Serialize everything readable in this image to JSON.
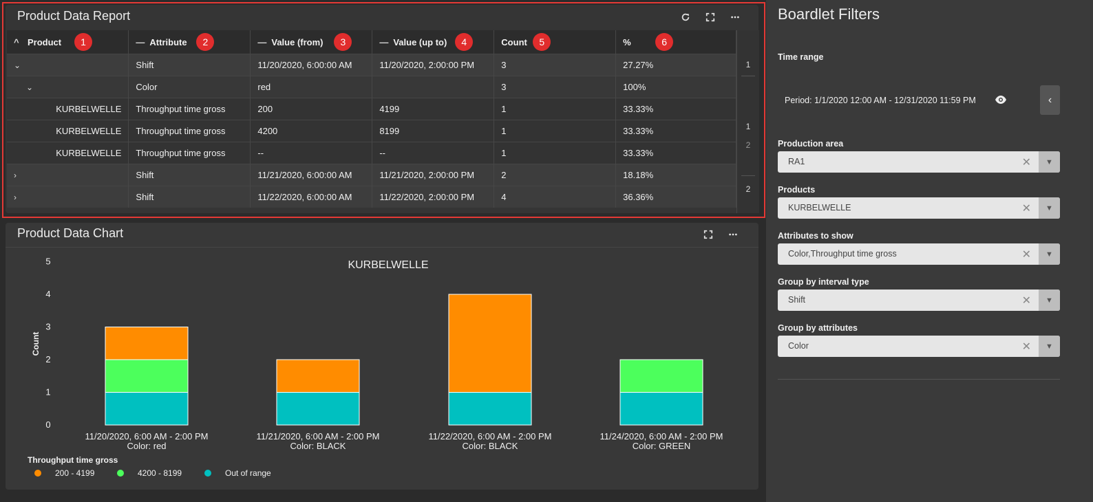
{
  "report": {
    "title": "Product Data Report",
    "toolbar": [
      "refresh-icon",
      "fullscreen-icon",
      "more-icon"
    ],
    "columns": [
      {
        "label": "Product",
        "icon": "^",
        "badge": "1"
      },
      {
        "label": "Attribute",
        "icon": "—",
        "badge": "2"
      },
      {
        "label": "Value (from)",
        "icon": "—",
        "badge": "3"
      },
      {
        "label": "Value (up to)",
        "icon": "—",
        "badge": "4"
      },
      {
        "label": "Count",
        "icon": "",
        "badge": "5"
      },
      {
        "label": "%",
        "icon": "",
        "badge": "6"
      }
    ],
    "rows": [
      {
        "kind": "shift",
        "chevron": "⌄",
        "product": "",
        "attribute": "Shift",
        "from": "11/20/2020, 6:00:00 AM",
        "to": "11/20/2020, 2:00:00 PM",
        "count": "3",
        "pct": "27.27%"
      },
      {
        "kind": "color",
        "chevron": "⌄",
        "product": "",
        "attribute": "Color",
        "from": "red",
        "to": "",
        "count": "3",
        "pct": "100%"
      },
      {
        "kind": "leaf",
        "chevron": "",
        "product": "KURBELWELLE",
        "attribute": "Throughput time gross",
        "from": "200",
        "to": "4199",
        "count": "1",
        "pct": "33.33%"
      },
      {
        "kind": "leaf",
        "chevron": "",
        "product": "KURBELWELLE",
        "attribute": "Throughput time gross",
        "from": "4200",
        "to": "8199",
        "count": "1",
        "pct": "33.33%"
      },
      {
        "kind": "leaf",
        "chevron": "",
        "product": "KURBELWELLE",
        "attribute": "Throughput time gross",
        "from": "--",
        "to": "--",
        "count": "1",
        "pct": "33.33%"
      },
      {
        "kind": "shift",
        "chevron": "›",
        "product": "",
        "attribute": "Shift",
        "from": "11/21/2020, 6:00:00 AM",
        "to": "11/21/2020, 2:00:00 PM",
        "count": "2",
        "pct": "18.18%"
      },
      {
        "kind": "shift",
        "chevron": "›",
        "product": "",
        "attribute": "Shift",
        "from": "11/22/2020, 6:00:00 AM",
        "to": "11/22/2020, 2:00:00 PM",
        "count": "4",
        "pct": "36.36%"
      }
    ],
    "pager": [
      "1",
      "1",
      "2",
      "2"
    ]
  },
  "chart": {
    "title": "Product Data Chart",
    "toolbar": [
      "fullscreen-icon",
      "more-icon"
    ]
  },
  "chart_data": {
    "type": "bar",
    "stacked": true,
    "title": "KURBELWELLE",
    "xlabel": "",
    "ylabel": "Count",
    "ylim": [
      0,
      5
    ],
    "yticks": [
      0,
      1,
      2,
      3,
      4,
      5
    ],
    "categories": [
      [
        "11/20/2020, 6:00 AM - 2:00 PM",
        "Color: red"
      ],
      [
        "11/21/2020, 6:00 AM - 2:00 PM",
        "Color: BLACK"
      ],
      [
        "11/22/2020, 6:00 AM - 2:00 PM",
        "Color: BLACK"
      ],
      [
        "11/24/2020, 6:00 AM - 2:00 PM",
        "Color: GREEN"
      ]
    ],
    "series": [
      {
        "name": "Out of range",
        "color": "#00c0c0",
        "values": [
          1,
          1,
          1,
          1
        ]
      },
      {
        "name": "4200 - 8199",
        "color": "#4cff5c",
        "values": [
          1,
          0,
          0,
          1
        ]
      },
      {
        "name": "200 - 4199",
        "color": "#ff8c00",
        "values": [
          1,
          1,
          3,
          0
        ]
      }
    ],
    "legend_title": "Throughput time gross",
    "legend_order": [
      "200 - 4199",
      "4200 - 8199",
      "Out of range"
    ],
    "legend_position": "bottom-left",
    "grid": false
  },
  "filters": {
    "title": "Boardlet Filters",
    "time_range_label": "Time range",
    "period": "Period: 1/1/2020 12:00 AM - 12/31/2020 11:59 PM",
    "fields": [
      {
        "label": "Production area",
        "value": "RA1"
      },
      {
        "label": "Products",
        "value": "KURBELWELLE"
      },
      {
        "label": "Attributes to show",
        "value": "Color,Throughput time gross"
      },
      {
        "label": "Group by interval type",
        "value": "Shift"
      },
      {
        "label": "Group by attributes",
        "value": "Color"
      }
    ],
    "clear_glyph": "✕",
    "dropdown_glyph": "▼",
    "collapse_glyph": "‹"
  }
}
